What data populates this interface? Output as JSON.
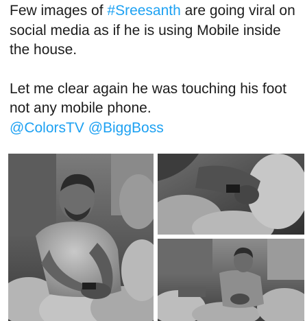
{
  "tweet": {
    "line1_prefix": "Few images of ",
    "hashtag": "#Sreesanth",
    "line1_suffix": " are going viral on social media as if he is using Mobile inside the house.",
    "line2": "Let me clear again he was touching his foot not any mobile phone.",
    "mention1": "@ColorsTV",
    "mention2": "@BiggBoss"
  },
  "colors": {
    "link": "#1da1f2",
    "text": "#1c1c1c"
  }
}
